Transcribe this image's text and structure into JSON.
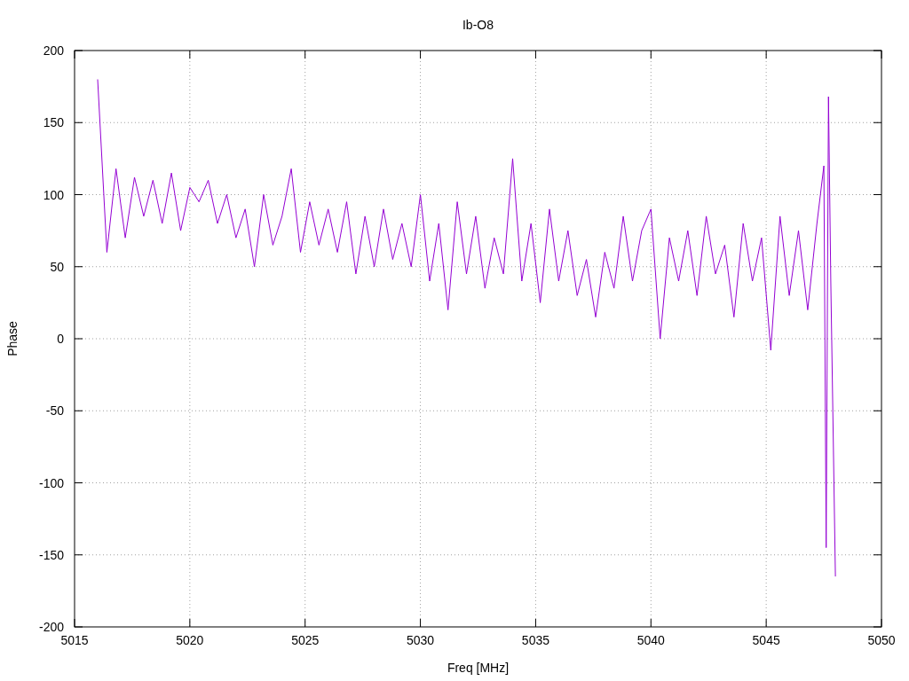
{
  "chart_data": {
    "type": "line",
    "title": "Ib-O8",
    "xlabel": "Freq [MHz]",
    "ylabel": "Phase",
    "grid": true,
    "xlim": [
      5015,
      5050
    ],
    "ylim": [
      -200,
      200
    ],
    "xticks": [
      5015,
      5020,
      5025,
      5030,
      5035,
      5040,
      5045,
      5050
    ],
    "yticks": [
      -200,
      -150,
      -100,
      -50,
      0,
      50,
      100,
      150,
      200
    ],
    "x": [
      5016.0,
      5016.4,
      5016.8,
      5017.2,
      5017.6,
      5018.0,
      5018.4,
      5018.8,
      5019.2,
      5019.6,
      5020.0,
      5020.4,
      5020.8,
      5021.2,
      5021.6,
      5022.0,
      5022.4,
      5022.8,
      5023.2,
      5023.6,
      5024.0,
      5024.4,
      5024.8,
      5025.2,
      5025.6,
      5026.0,
      5026.4,
      5026.8,
      5027.2,
      5027.6,
      5028.0,
      5028.4,
      5028.8,
      5029.2,
      5029.6,
      5030.0,
      5030.4,
      5030.8,
      5031.2,
      5031.6,
      5032.0,
      5032.4,
      5032.8,
      5033.2,
      5033.6,
      5034.0,
      5034.4,
      5034.8,
      5035.2,
      5035.6,
      5036.0,
      5036.4,
      5036.8,
      5037.2,
      5037.6,
      5038.0,
      5038.4,
      5038.8,
      5039.2,
      5039.6,
      5040.0,
      5040.4,
      5040.8,
      5041.2,
      5041.6,
      5042.0,
      5042.4,
      5042.8,
      5043.2,
      5043.6,
      5044.0,
      5044.4,
      5044.8,
      5045.2,
      5045.6,
      5046.0,
      5046.4,
      5046.8,
      5047.2,
      5047.5,
      5047.6,
      5047.7,
      5047.8,
      5048.0
    ],
    "series": [
      {
        "color": "#9400d3",
        "values": [
          180,
          60,
          118,
          70,
          112,
          85,
          110,
          80,
          115,
          75,
          105,
          95,
          110,
          80,
          100,
          70,
          90,
          50,
          100,
          65,
          85,
          118,
          60,
          95,
          65,
          90,
          60,
          95,
          45,
          85,
          50,
          90,
          55,
          80,
          50,
          100,
          40,
          80,
          20,
          95,
          45,
          85,
          35,
          70,
          45,
          125,
          40,
          80,
          25,
          90,
          40,
          75,
          30,
          55,
          15,
          60,
          35,
          85,
          40,
          75,
          90,
          0,
          70,
          40,
          75,
          30,
          85,
          45,
          65,
          15,
          80,
          40,
          70,
          -8,
          85,
          30,
          75,
          20,
          80,
          120,
          -145,
          168,
          40,
          -165
        ]
      }
    ]
  }
}
